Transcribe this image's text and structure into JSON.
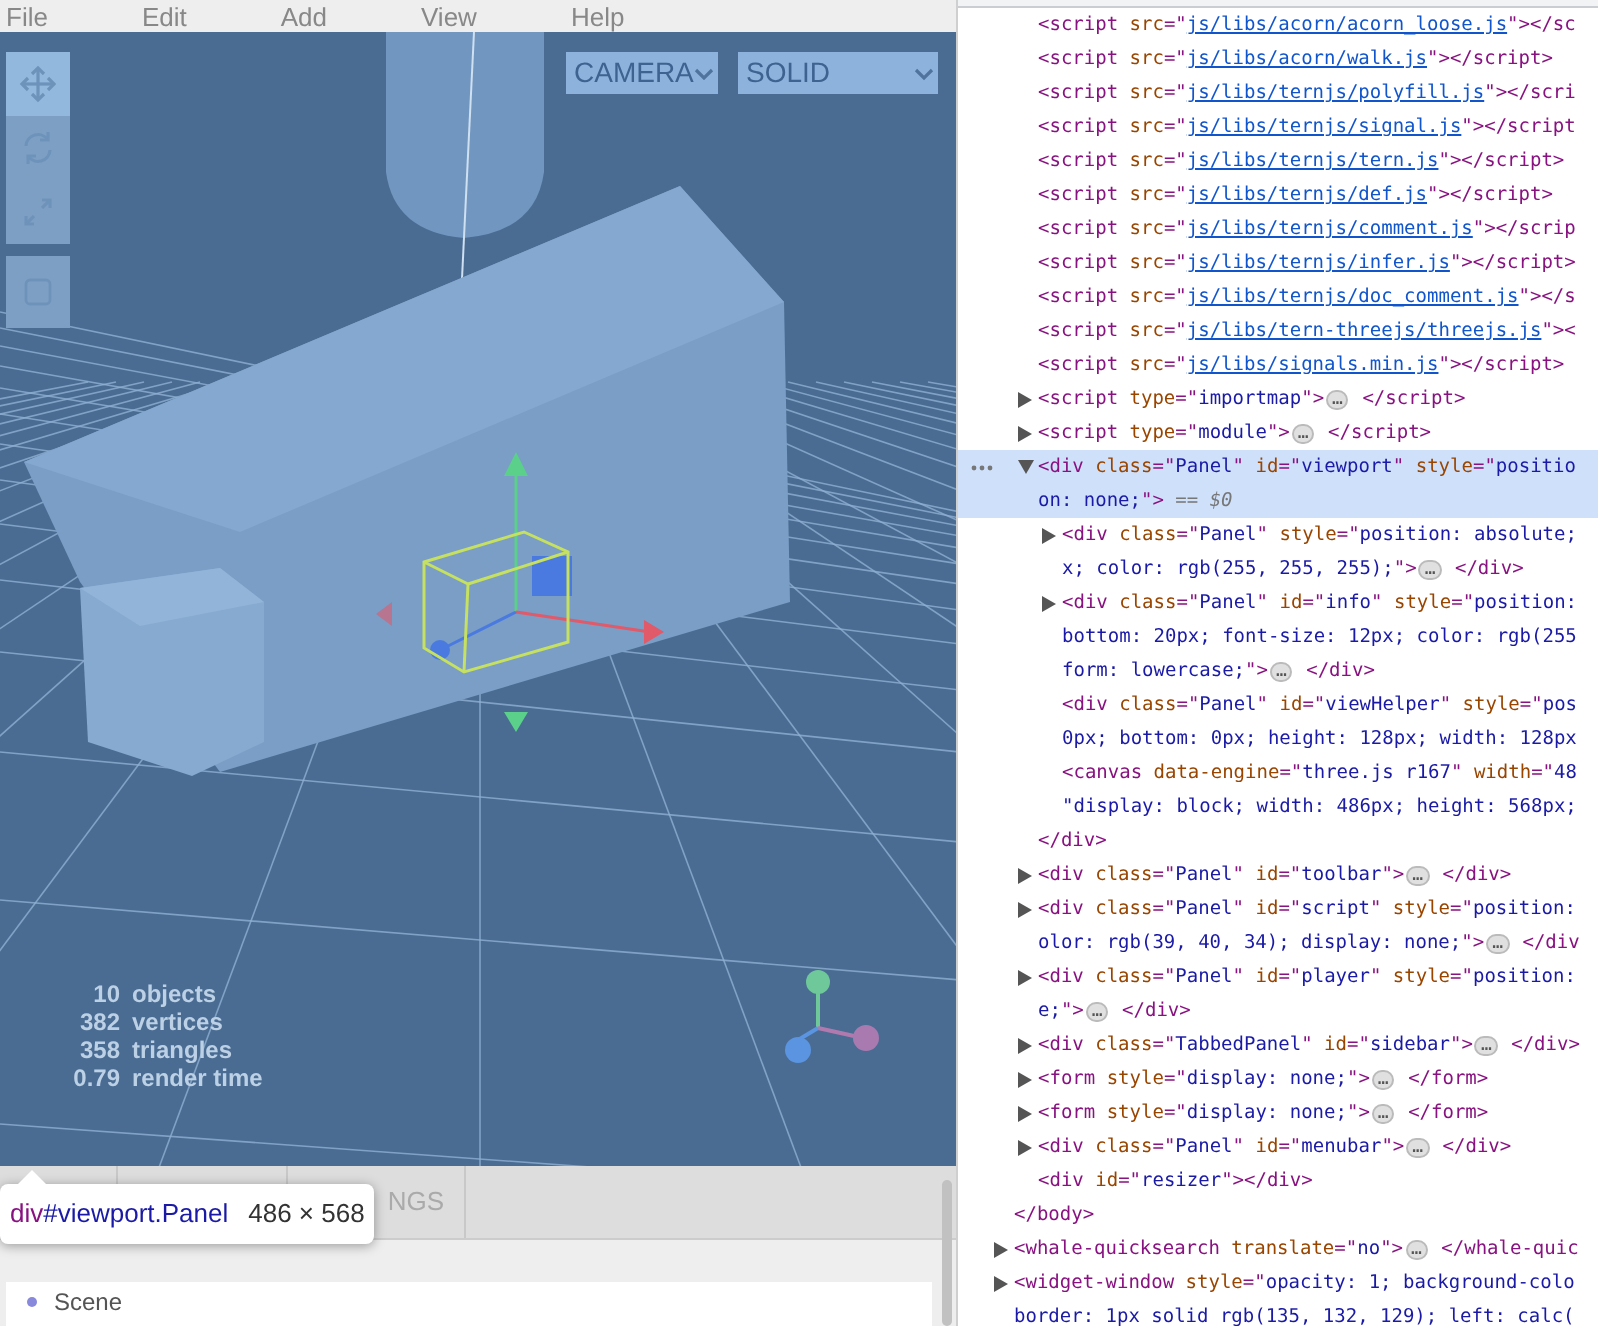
{
  "menubar": {
    "items": [
      "File",
      "Edit",
      "Add",
      "View",
      "Help"
    ]
  },
  "viewport": {
    "toolbar": [
      {
        "selected": true
      },
      {
        "selected": false
      },
      {
        "selected": false
      },
      {
        "selected": false
      }
    ],
    "selects": [
      {
        "value": "CAMERA"
      },
      {
        "value": "SOLID"
      }
    ],
    "info": [
      {
        "count": "10",
        "name": "objects"
      },
      {
        "count": "382",
        "name": "vertices"
      },
      {
        "count": "358",
        "name": "triangles"
      },
      {
        "count": "0.79",
        "name": "render time"
      }
    ]
  },
  "inspect_tooltip": {
    "tag": "div",
    "selector": "#viewport.Panel",
    "size": "486 × 568"
  },
  "sidebar": {
    "tabs": [
      {
        "label": "NGS",
        "selected": false
      }
    ],
    "outliner": [
      {
        "label": "Scene"
      }
    ]
  },
  "elements_panel": {
    "nodes": [
      {
        "closing": [
          {
            "kind": "tag",
            "text": "</body>"
          }
        ],
        "children": [
          {
            "selected": false,
            "lines": [
              [
                {
                  "kind": "tag",
                  "text": "<script "
                },
                {
                  "kind": "attr",
                  "text": "src"
                },
                {
                  "kind": "tag",
                  "text": "=\""
                },
                {
                  "kind": "link",
                  "text": "js/libs/acorn/acorn_loose.js"
                },
                {
                  "kind": "tag",
                  "text": "\"></sc"
                }
              ]
            ]
          },
          {
            "selected": false,
            "lines": [
              [
                {
                  "kind": "tag",
                  "text": "<script "
                },
                {
                  "kind": "attr",
                  "text": "src"
                },
                {
                  "kind": "tag",
                  "text": "=\""
                },
                {
                  "kind": "link",
                  "text": "js/libs/acorn/walk.js"
                },
                {
                  "kind": "tag",
                  "text": "\"></script>"
                }
              ]
            ]
          },
          {
            "selected": false,
            "lines": [
              [
                {
                  "kind": "tag",
                  "text": "<script "
                },
                {
                  "kind": "attr",
                  "text": "src"
                },
                {
                  "kind": "tag",
                  "text": "=\""
                },
                {
                  "kind": "link",
                  "text": "js/libs/ternjs/polyfill.js"
                },
                {
                  "kind": "tag",
                  "text": "\"></scri"
                }
              ]
            ]
          },
          {
            "selected": false,
            "lines": [
              [
                {
                  "kind": "tag",
                  "text": "<script "
                },
                {
                  "kind": "attr",
                  "text": "src"
                },
                {
                  "kind": "tag",
                  "text": "=\""
                },
                {
                  "kind": "link",
                  "text": "js/libs/ternjs/signal.js"
                },
                {
                  "kind": "tag",
                  "text": "\"></script"
                }
              ]
            ]
          },
          {
            "selected": false,
            "lines": [
              [
                {
                  "kind": "tag",
                  "text": "<script "
                },
                {
                  "kind": "attr",
                  "text": "src"
                },
                {
                  "kind": "tag",
                  "text": "=\""
                },
                {
                  "kind": "link",
                  "text": "js/libs/ternjs/tern.js"
                },
                {
                  "kind": "tag",
                  "text": "\"></script>"
                }
              ]
            ]
          },
          {
            "selected": false,
            "lines": [
              [
                {
                  "kind": "tag",
                  "text": "<script "
                },
                {
                  "kind": "attr",
                  "text": "src"
                },
                {
                  "kind": "tag",
                  "text": "=\""
                },
                {
                  "kind": "link",
                  "text": "js/libs/ternjs/def.js"
                },
                {
                  "kind": "tag",
                  "text": "\"></script>"
                }
              ]
            ]
          },
          {
            "selected": false,
            "lines": [
              [
                {
                  "kind": "tag",
                  "text": "<script "
                },
                {
                  "kind": "attr",
                  "text": "src"
                },
                {
                  "kind": "tag",
                  "text": "=\""
                },
                {
                  "kind": "link",
                  "text": "js/libs/ternjs/comment.js"
                },
                {
                  "kind": "tag",
                  "text": "\"></scrip"
                }
              ]
            ]
          },
          {
            "selected": false,
            "lines": [
              [
                {
                  "kind": "tag",
                  "text": "<script "
                },
                {
                  "kind": "attr",
                  "text": "src"
                },
                {
                  "kind": "tag",
                  "text": "=\""
                },
                {
                  "kind": "link",
                  "text": "js/libs/ternjs/infer.js"
                },
                {
                  "kind": "tag",
                  "text": "\"></script>"
                }
              ]
            ]
          },
          {
            "selected": false,
            "lines": [
              [
                {
                  "kind": "tag",
                  "text": "<script "
                },
                {
                  "kind": "attr",
                  "text": "src"
                },
                {
                  "kind": "tag",
                  "text": "=\""
                },
                {
                  "kind": "link",
                  "text": "js/libs/ternjs/doc_comment.js"
                },
                {
                  "kind": "tag",
                  "text": "\"></s"
                }
              ]
            ]
          },
          {
            "selected": false,
            "lines": [
              [
                {
                  "kind": "tag",
                  "text": "<script "
                },
                {
                  "kind": "attr",
                  "text": "src"
                },
                {
                  "kind": "tag",
                  "text": "=\""
                },
                {
                  "kind": "link",
                  "text": "js/libs/tern-threejs/threejs.js"
                },
                {
                  "kind": "tag",
                  "text": "\"><"
                }
              ]
            ]
          },
          {
            "selected": false,
            "lines": [
              [
                {
                  "kind": "tag",
                  "text": "<script "
                },
                {
                  "kind": "attr",
                  "text": "src"
                },
                {
                  "kind": "tag",
                  "text": "=\""
                },
                {
                  "kind": "link",
                  "text": "js/libs/signals.min.js"
                },
                {
                  "kind": "tag",
                  "text": "\"></script>"
                }
              ]
            ]
          },
          {
            "selected": false,
            "expanded": false,
            "lines": [
              [
                {
                  "kind": "tag",
                  "text": "<script "
                },
                {
                  "kind": "attr",
                  "text": "type"
                },
                {
                  "kind": "tag",
                  "text": "=\""
                },
                {
                  "kind": "val",
                  "text": "importmap"
                },
                {
                  "kind": "tag",
                  "text": "\">"
                },
                {
                  "kind": "more",
                  "text": "…"
                },
                {
                  "kind": "tag",
                  "text": " </script>"
                }
              ]
            ]
          },
          {
            "selected": false,
            "expanded": false,
            "lines": [
              [
                {
                  "kind": "tag",
                  "text": "<script "
                },
                {
                  "kind": "attr",
                  "text": "type"
                },
                {
                  "kind": "tag",
                  "text": "=\""
                },
                {
                  "kind": "val",
                  "text": "module"
                },
                {
                  "kind": "tag",
                  "text": "\">"
                },
                {
                  "kind": "more",
                  "text": "…"
                },
                {
                  "kind": "tag",
                  "text": " </script>"
                }
              ]
            ]
          },
          {
            "selected": true,
            "expanded": true,
            "lines": [
              [
                {
                  "kind": "tag",
                  "text": "<div "
                },
                {
                  "kind": "attr",
                  "text": "class"
                },
                {
                  "kind": "tag",
                  "text": "=\""
                },
                {
                  "kind": "val",
                  "text": "Panel"
                },
                {
                  "kind": "tag",
                  "text": "\" "
                },
                {
                  "kind": "attr",
                  "text": "id"
                },
                {
                  "kind": "tag",
                  "text": "=\""
                },
                {
                  "kind": "val",
                  "text": "viewport"
                },
                {
                  "kind": "tag",
                  "text": "\" "
                },
                {
                  "kind": "attr",
                  "text": "style"
                },
                {
                  "kind": "tag",
                  "text": "=\""
                },
                {
                  "kind": "val",
                  "text": "positio"
                }
              ],
              [
                {
                  "kind": "val",
                  "text": "on: none;"
                },
                {
                  "kind": "tag",
                  "text": "\">"
                },
                {
                  "kind": "note",
                  "text": " == $0"
                }
              ]
            ],
            "closing": [
              {
                "kind": "tag",
                "text": "</div>"
              }
            ],
            "children": [
              {
                "selected": false,
                "expanded": false,
                "lines": [
                  [
                    {
                      "kind": "tag",
                      "text": "<div "
                    },
                    {
                      "kind": "attr",
                      "text": "class"
                    },
                    {
                      "kind": "tag",
                      "text": "=\""
                    },
                    {
                      "kind": "val",
                      "text": "Panel"
                    },
                    {
                      "kind": "tag",
                      "text": "\" "
                    },
                    {
                      "kind": "attr",
                      "text": "style"
                    },
                    {
                      "kind": "tag",
                      "text": "=\""
                    },
                    {
                      "kind": "val",
                      "text": "position: absolute;"
                    }
                  ],
                  [
                    {
                      "kind": "val",
                      "text": "x; color: rgb(255, 255, 255);"
                    },
                    {
                      "kind": "tag",
                      "text": "\">"
                    },
                    {
                      "kind": "more",
                      "text": "…"
                    },
                    {
                      "kind": "tag",
                      "text": " </div>"
                    }
                  ]
                ]
              },
              {
                "selected": false,
                "expanded": false,
                "lines": [
                  [
                    {
                      "kind": "tag",
                      "text": "<div "
                    },
                    {
                      "kind": "attr",
                      "text": "class"
                    },
                    {
                      "kind": "tag",
                      "text": "=\""
                    },
                    {
                      "kind": "val",
                      "text": "Panel"
                    },
                    {
                      "kind": "tag",
                      "text": "\" "
                    },
                    {
                      "kind": "attr",
                      "text": "id"
                    },
                    {
                      "kind": "tag",
                      "text": "=\""
                    },
                    {
                      "kind": "val",
                      "text": "info"
                    },
                    {
                      "kind": "tag",
                      "text": "\" "
                    },
                    {
                      "kind": "attr",
                      "text": "style"
                    },
                    {
                      "kind": "tag",
                      "text": "=\""
                    },
                    {
                      "kind": "val",
                      "text": "position:"
                    }
                  ],
                  [
                    {
                      "kind": "val",
                      "text": "bottom: 20px; font-size: 12px; color: rgb(255"
                    }
                  ],
                  [
                    {
                      "kind": "val",
                      "text": "form: lowercase;"
                    },
                    {
                      "kind": "tag",
                      "text": "\">"
                    },
                    {
                      "kind": "more",
                      "text": "…"
                    },
                    {
                      "kind": "tag",
                      "text": " </div>"
                    }
                  ]
                ]
              },
              {
                "selected": false,
                "lines": [
                  [
                    {
                      "kind": "tag",
                      "text": "<div "
                    },
                    {
                      "kind": "attr",
                      "text": "class"
                    },
                    {
                      "kind": "tag",
                      "text": "=\""
                    },
                    {
                      "kind": "val",
                      "text": "Panel"
                    },
                    {
                      "kind": "tag",
                      "text": "\" "
                    },
                    {
                      "kind": "attr",
                      "text": "id"
                    },
                    {
                      "kind": "tag",
                      "text": "=\""
                    },
                    {
                      "kind": "val",
                      "text": "viewHelper"
                    },
                    {
                      "kind": "tag",
                      "text": "\" "
                    },
                    {
                      "kind": "attr",
                      "text": "style"
                    },
                    {
                      "kind": "tag",
                      "text": "=\""
                    },
                    {
                      "kind": "val",
                      "text": "pos"
                    }
                  ],
                  [
                    {
                      "kind": "val",
                      "text": "0px; bottom: 0px; height: 128px; width: 128px"
                    }
                  ]
                ]
              },
              {
                "selected": false,
                "lines": [
                  [
                    {
                      "kind": "tag",
                      "text": "<canvas "
                    },
                    {
                      "kind": "attr",
                      "text": "data-engine"
                    },
                    {
                      "kind": "tag",
                      "text": "=\""
                    },
                    {
                      "kind": "val",
                      "text": "three.js r167"
                    },
                    {
                      "kind": "tag",
                      "text": "\" "
                    },
                    {
                      "kind": "attr",
                      "text": "width"
                    },
                    {
                      "kind": "tag",
                      "text": "=\""
                    },
                    {
                      "kind": "val",
                      "text": "48"
                    }
                  ],
                  [
                    {
                      "kind": "val",
                      "text": "\"display: block; width: 486px; height: 568px;"
                    }
                  ]
                ]
              }
            ]
          },
          {
            "selected": false,
            "expanded": false,
            "lines": [
              [
                {
                  "kind": "tag",
                  "text": "<div "
                },
                {
                  "kind": "attr",
                  "text": "class"
                },
                {
                  "kind": "tag",
                  "text": "=\""
                },
                {
                  "kind": "val",
                  "text": "Panel"
                },
                {
                  "kind": "tag",
                  "text": "\" "
                },
                {
                  "kind": "attr",
                  "text": "id"
                },
                {
                  "kind": "tag",
                  "text": "=\""
                },
                {
                  "kind": "val",
                  "text": "toolbar"
                },
                {
                  "kind": "tag",
                  "text": "\">"
                },
                {
                  "kind": "more",
                  "text": "…"
                },
                {
                  "kind": "tag",
                  "text": " </div>"
                }
              ]
            ]
          },
          {
            "selected": false,
            "expanded": false,
            "lines": [
              [
                {
                  "kind": "tag",
                  "text": "<div "
                },
                {
                  "kind": "attr",
                  "text": "class"
                },
                {
                  "kind": "tag",
                  "text": "=\""
                },
                {
                  "kind": "val",
                  "text": "Panel"
                },
                {
                  "kind": "tag",
                  "text": "\" "
                },
                {
                  "kind": "attr",
                  "text": "id"
                },
                {
                  "kind": "tag",
                  "text": "=\""
                },
                {
                  "kind": "val",
                  "text": "script"
                },
                {
                  "kind": "tag",
                  "text": "\" "
                },
                {
                  "kind": "attr",
                  "text": "style"
                },
                {
                  "kind": "tag",
                  "text": "=\""
                },
                {
                  "kind": "val",
                  "text": "position:"
                }
              ],
              [
                {
                  "kind": "val",
                  "text": "olor: rgb(39, 40, 34); display: none;"
                },
                {
                  "kind": "tag",
                  "text": "\">"
                },
                {
                  "kind": "more",
                  "text": "…"
                },
                {
                  "kind": "tag",
                  "text": " </div"
                }
              ]
            ]
          },
          {
            "selected": false,
            "expanded": false,
            "lines": [
              [
                {
                  "kind": "tag",
                  "text": "<div "
                },
                {
                  "kind": "attr",
                  "text": "class"
                },
                {
                  "kind": "tag",
                  "text": "=\""
                },
                {
                  "kind": "val",
                  "text": "Panel"
                },
                {
                  "kind": "tag",
                  "text": "\" "
                },
                {
                  "kind": "attr",
                  "text": "id"
                },
                {
                  "kind": "tag",
                  "text": "=\""
                },
                {
                  "kind": "val",
                  "text": "player"
                },
                {
                  "kind": "tag",
                  "text": "\" "
                },
                {
                  "kind": "attr",
                  "text": "style"
                },
                {
                  "kind": "tag",
                  "text": "=\""
                },
                {
                  "kind": "val",
                  "text": "position:"
                }
              ],
              [
                {
                  "kind": "val",
                  "text": "e;"
                },
                {
                  "kind": "tag",
                  "text": "\">"
                },
                {
                  "kind": "more",
                  "text": "…"
                },
                {
                  "kind": "tag",
                  "text": " </div>"
                }
              ]
            ]
          },
          {
            "selected": false,
            "expanded": false,
            "lines": [
              [
                {
                  "kind": "tag",
                  "text": "<div "
                },
                {
                  "kind": "attr",
                  "text": "class"
                },
                {
                  "kind": "tag",
                  "text": "=\""
                },
                {
                  "kind": "val",
                  "text": "TabbedPanel"
                },
                {
                  "kind": "tag",
                  "text": "\" "
                },
                {
                  "kind": "attr",
                  "text": "id"
                },
                {
                  "kind": "tag",
                  "text": "=\""
                },
                {
                  "kind": "val",
                  "text": "sidebar"
                },
                {
                  "kind": "tag",
                  "text": "\">"
                },
                {
                  "kind": "more",
                  "text": "…"
                },
                {
                  "kind": "tag",
                  "text": " </div>"
                }
              ]
            ]
          },
          {
            "selected": false,
            "expanded": false,
            "lines": [
              [
                {
                  "kind": "tag",
                  "text": "<form "
                },
                {
                  "kind": "attr",
                  "text": "style"
                },
                {
                  "kind": "tag",
                  "text": "=\""
                },
                {
                  "kind": "val",
                  "text": "display: none;"
                },
                {
                  "kind": "tag",
                  "text": "\">"
                },
                {
                  "kind": "more",
                  "text": "…"
                },
                {
                  "kind": "tag",
                  "text": " </form>"
                }
              ]
            ]
          },
          {
            "selected": false,
            "expanded": false,
            "lines": [
              [
                {
                  "kind": "tag",
                  "text": "<form "
                },
                {
                  "kind": "attr",
                  "text": "style"
                },
                {
                  "kind": "tag",
                  "text": "=\""
                },
                {
                  "kind": "val",
                  "text": "display: none;"
                },
                {
                  "kind": "tag",
                  "text": "\">"
                },
                {
                  "kind": "more",
                  "text": "…"
                },
                {
                  "kind": "tag",
                  "text": " </form>"
                }
              ]
            ]
          },
          {
            "selected": false,
            "expanded": false,
            "lines": [
              [
                {
                  "kind": "tag",
                  "text": "<div "
                },
                {
                  "kind": "attr",
                  "text": "class"
                },
                {
                  "kind": "tag",
                  "text": "=\""
                },
                {
                  "kind": "val",
                  "text": "Panel"
                },
                {
                  "kind": "tag",
                  "text": "\" "
                },
                {
                  "kind": "attr",
                  "text": "id"
                },
                {
                  "kind": "tag",
                  "text": "=\""
                },
                {
                  "kind": "val",
                  "text": "menubar"
                },
                {
                  "kind": "tag",
                  "text": "\">"
                },
                {
                  "kind": "more",
                  "text": "…"
                },
                {
                  "kind": "tag",
                  "text": " </div>"
                }
              ]
            ]
          },
          {
            "selected": false,
            "lines": [
              [
                {
                  "kind": "tag",
                  "text": "<div "
                },
                {
                  "kind": "attr",
                  "text": "id"
                },
                {
                  "kind": "tag",
                  "text": "=\""
                },
                {
                  "kind": "val",
                  "text": "resizer"
                },
                {
                  "kind": "tag",
                  "text": "\"></div>"
                }
              ]
            ]
          }
        ]
      },
      {
        "selected": false,
        "expanded": false,
        "lines": [
          [
            {
              "kind": "tag",
              "text": "<whale-quicksearch "
            },
            {
              "kind": "attr",
              "text": "translate"
            },
            {
              "kind": "tag",
              "text": "=\""
            },
            {
              "kind": "val",
              "text": "no"
            },
            {
              "kind": "tag",
              "text": "\">"
            },
            {
              "kind": "more",
              "text": "…"
            },
            {
              "kind": "tag",
              "text": " </whale-quic"
            }
          ]
        ]
      },
      {
        "selected": false,
        "expanded": false,
        "lines": [
          [
            {
              "kind": "tag",
              "text": "<widget-window "
            },
            {
              "kind": "attr",
              "text": "style"
            },
            {
              "kind": "tag",
              "text": "=\""
            },
            {
              "kind": "val",
              "text": "opacity: 1; background-colo"
            }
          ],
          [
            {
              "kind": "val",
              "text": "border: 1px solid rgb(135, 132, 129); left: calc("
            }
          ]
        ]
      }
    ]
  }
}
